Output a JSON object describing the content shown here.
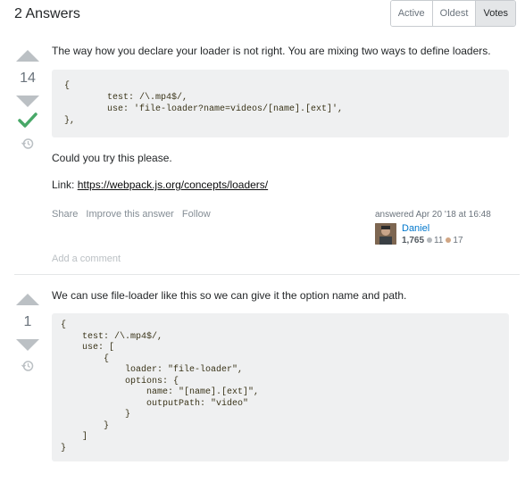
{
  "header": {
    "answers_count": "2 Answers",
    "tabs": [
      {
        "label": "Active"
      },
      {
        "label": "Oldest"
      },
      {
        "label": "Votes",
        "active": true
      }
    ]
  },
  "answers": [
    {
      "votes": "14",
      "accepted": true,
      "intro": "The way how you declare your loader is not right. You are mixing two ways to define loaders.",
      "code": "{\n        test: /\\.mp4$/,\n        use: 'file-loader?name=videos/[name].[ext]',\n},",
      "p2": "Could you try this please.",
      "link_prefix": "Link: ",
      "link_text": "https://webpack.js.org/concepts/loaders/",
      "menu": {
        "share": "Share",
        "improve": "Improve this answer",
        "follow": "Follow"
      },
      "signature": {
        "action": "answered Apr 20 '18 at 16:48",
        "user": "Daniel",
        "reputation": "1,765",
        "silver": "11",
        "bronze": "17"
      },
      "add_comment": "Add a comment"
    },
    {
      "votes": "1",
      "accepted": false,
      "intro": "We can use file-loader like this so we can give it the option name and path.",
      "code": "{\n    test: /\\.mp4$/,\n    use: [\n        {\n            loader: \"file-loader\",\n            options: {\n                name: \"[name].[ext]\",\n                outputPath: \"video\"\n            }\n        }\n    ]\n}"
    }
  ],
  "colors": {
    "accepted": "#48a868",
    "silver": "#b4b8bc",
    "bronze": "#d1a684",
    "link": "#0c0d0e"
  }
}
